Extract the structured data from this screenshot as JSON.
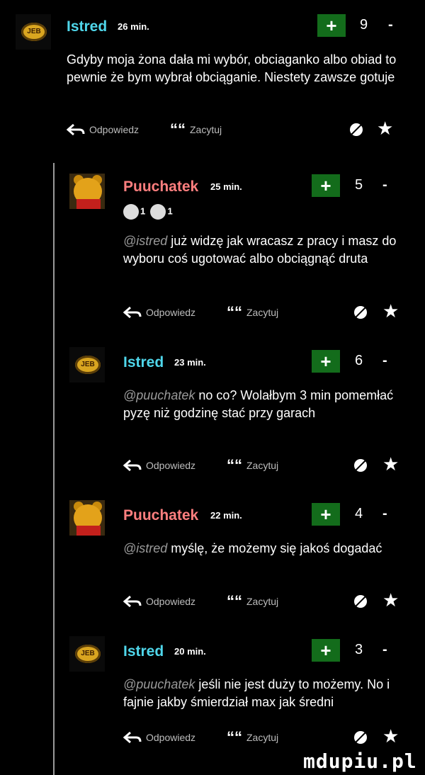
{
  "labels": {
    "reply": "Odpowiedz",
    "quote": "Zacytuj",
    "plus": "+",
    "minus": "-",
    "quote_icon": "““",
    "star": "★"
  },
  "comments": [
    {
      "user": "Istred",
      "time": "26 min.",
      "score": "9",
      "mention": "",
      "text": "Gdyby moja żona dała mi wybór, obciaganko albo obiad to pewnie że bym wybrał obciąganie. Niestety zawsze gotuje"
    },
    {
      "user": "Puuchatek",
      "time": "25 min.",
      "score": "5",
      "badge1": "1",
      "badge2": "1",
      "mention": "@istred",
      "text": " już widzę jak wracasz z pracy i masz do wyboru coś ugotować albo obciągnąć druta"
    },
    {
      "user": "Istred",
      "time": "23 min.",
      "score": "6",
      "mention": "@puuchatek",
      "text": " no co? Wolałbym 3 min pomemłać pyzę niż godzinę stać przy garach"
    },
    {
      "user": "Puuchatek",
      "time": "22 min.",
      "score": "4",
      "mention": "@istred",
      "text": " myślę, że możemy się jakoś dogadać"
    },
    {
      "user": "Istred",
      "time": "20 min.",
      "score": "3",
      "mention": "@puuchatek",
      "text": " jeśli nie jest duży to możemy. No i fajnie jakby śmierdział max jak średni"
    }
  ],
  "avatar_badge": "JEB",
  "watermark": "mdupiu.pl",
  "colors": {
    "istred": "#4fd6ea",
    "puuchatek": "#ff7f7f",
    "plus_bg": "#136c1b",
    "thread_line": "#9a9a9a"
  },
  "icons": [
    "reply-arrow-icon",
    "quote-icon",
    "mute-icon",
    "star-icon",
    "badge-icon"
  ]
}
